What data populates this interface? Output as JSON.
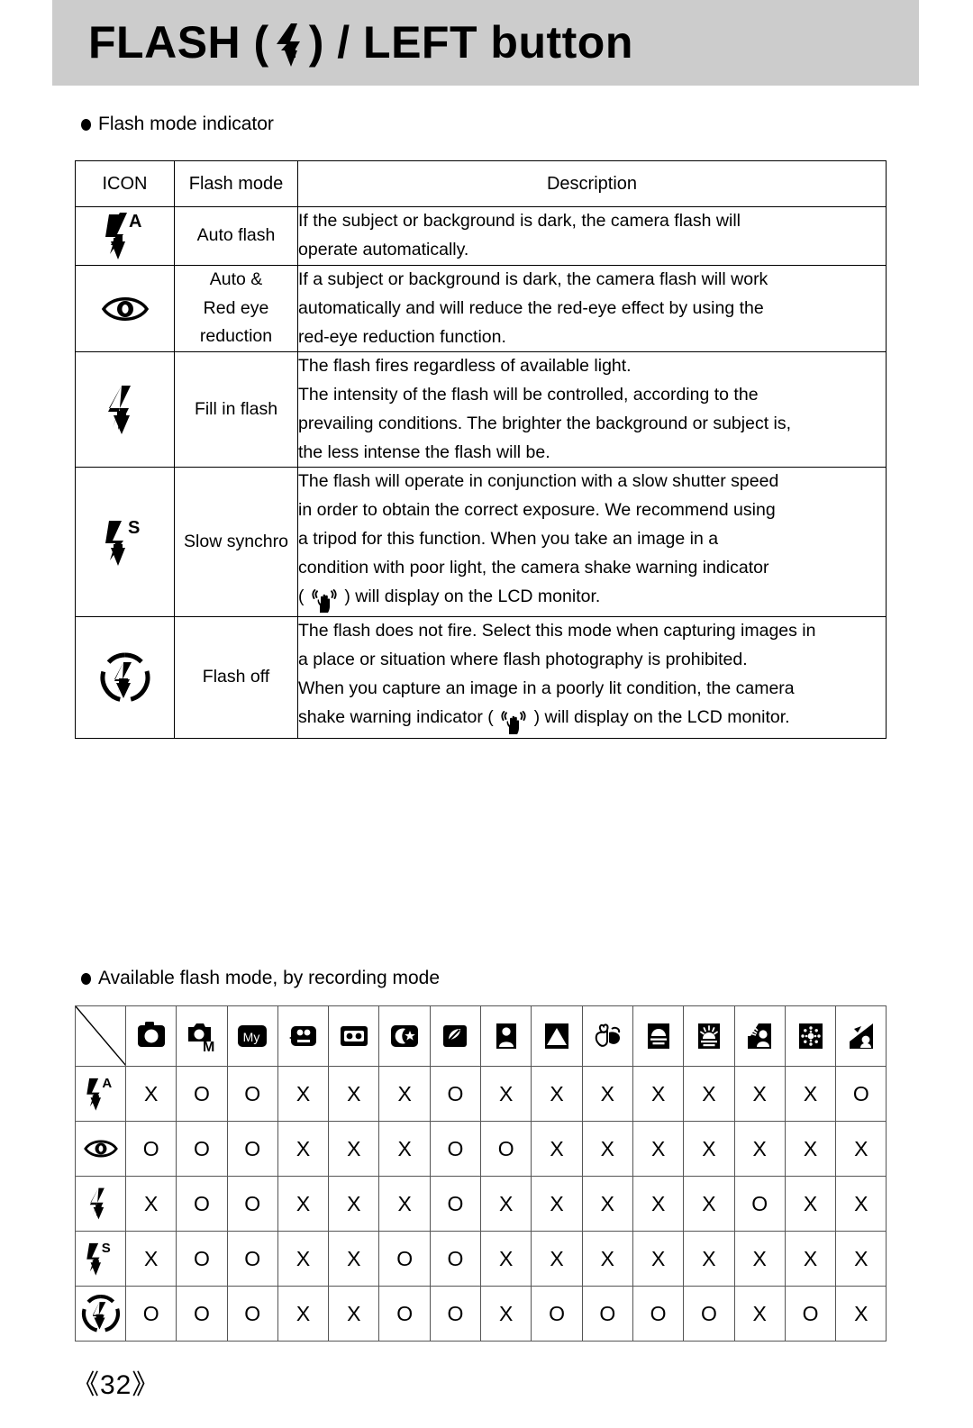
{
  "header": {
    "title_prefix": "FLASH (",
    "title_icon": "flash-bolt-icon",
    "title_suffix": ") / LEFT button"
  },
  "sections": {
    "flash_mode_indicator": "Flash mode indicator",
    "available_flash_mode": "Available flash mode, by recording mode"
  },
  "desc_table": {
    "headers": [
      "ICON",
      "Flash mode",
      "Description"
    ],
    "rows": [
      {
        "icon": "flash-auto-icon",
        "mode": [
          "Auto flash"
        ],
        "desc": [
          {
            "text": "If the subject or background is dark, the camera flash will"
          },
          {
            "text": "operate automatically."
          }
        ]
      },
      {
        "icon": "red-eye-icon",
        "mode": [
          "Auto &",
          "Red eye",
          "reduction"
        ],
        "desc": [
          {
            "text": "If a subject or background is dark, the camera flash will work"
          },
          {
            "text": "automatically and will reduce the red-eye effect by using the"
          },
          {
            "text": "red-eye reduction function."
          }
        ]
      },
      {
        "icon": "flash-fill-icon",
        "mode": [
          "Fill in flash"
        ],
        "desc": [
          {
            "text": "The flash fires regardless of available light."
          },
          {
            "text": "The intensity of the flash will be controlled, according to the"
          },
          {
            "text": "prevailing conditions. The brighter the background or subject is,"
          },
          {
            "text": "the less intense the flash will be."
          }
        ]
      },
      {
        "icon": "flash-slow-sync-icon",
        "mode": [
          "Slow synchro"
        ],
        "desc": [
          {
            "text": "The flash will operate in conjunction with a slow shutter speed"
          },
          {
            "text": "in order to obtain the correct exposure. We recommend using"
          },
          {
            "text": "a tripod for this function. When you take an image in a"
          },
          {
            "text": "condition with poor light, the camera shake warning indicator"
          },
          {
            "pre": "( ",
            "icon": "camera-shake-icon",
            "post": " ) will display on the LCD monitor."
          }
        ]
      },
      {
        "icon": "flash-off-icon",
        "mode": [
          "Flash off"
        ],
        "desc": [
          {
            "text": "The flash does not fire. Select this mode when capturing images in"
          },
          {
            "text": "a place or situation where flash photography is prohibited."
          },
          {
            "text": "When you capture an image in a poorly lit condition, the camera"
          },
          {
            "pre": "shake warning indicator ( ",
            "icon": "camera-shake-icon",
            "post": " ) will display on the LCD monitor."
          }
        ]
      }
    ]
  },
  "matrix_table": {
    "mode_icons": [
      "auto-camera-icon",
      "manual-camera-icon",
      "my-set-icon",
      "movie-clip-icon",
      "voice-recording-icon",
      "night-scene-icon",
      "high-speed-icon",
      "portrait-icon",
      "landscape-icon",
      "close-up-icon",
      "sunset-icon",
      "dawn-icon",
      "backlight-icon",
      "fireworks-icon",
      "beach-snow-icon"
    ],
    "row_icons": [
      "flash-auto-icon",
      "red-eye-icon",
      "flash-fill-icon",
      "flash-slow-sync-icon",
      "flash-off-icon"
    ],
    "values": [
      [
        "X",
        "O",
        "O",
        "X",
        "X",
        "X",
        "O",
        "X",
        "X",
        "X",
        "X",
        "X",
        "X",
        "X",
        "O"
      ],
      [
        "O",
        "O",
        "O",
        "X",
        "X",
        "X",
        "O",
        "O",
        "X",
        "X",
        "X",
        "X",
        "X",
        "X",
        "X"
      ],
      [
        "X",
        "O",
        "O",
        "X",
        "X",
        "X",
        "O",
        "X",
        "X",
        "X",
        "X",
        "X",
        "O",
        "X",
        "X"
      ],
      [
        "X",
        "O",
        "O",
        "X",
        "X",
        "O",
        "O",
        "X",
        "X",
        "X",
        "X",
        "X",
        "X",
        "X",
        "X"
      ],
      [
        "O",
        "O",
        "O",
        "X",
        "X",
        "O",
        "O",
        "X",
        "O",
        "O",
        "O",
        "O",
        "X",
        "O",
        "X"
      ]
    ]
  },
  "footer": {
    "page_number": "《32》"
  },
  "colors": {
    "header_band": "#cccccc",
    "text": "#000000",
    "table_border": "#000000"
  }
}
